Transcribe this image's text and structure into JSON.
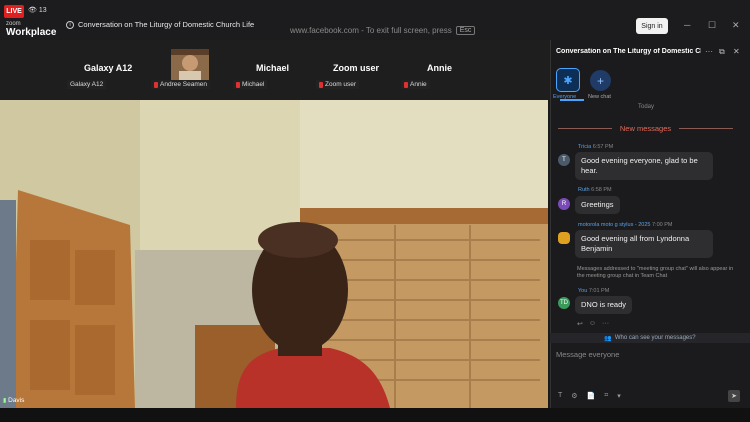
{
  "topbar": {
    "live_label": "LIVE",
    "viewer_count": "13",
    "brand_small": "zoom",
    "brand_large": "Workplace",
    "meeting_title": "Conversation on The Liturgy of Domestic Church Life",
    "fullscreen_notice": "www.facebook.com - To exit full screen, press",
    "esc_key": "Esc",
    "sign_in": "Sign in"
  },
  "gallery": [
    {
      "name": "Galaxy A12",
      "label": "Galaxy A12",
      "muted": false
    },
    {
      "name": "",
      "label": "Andree Seamen",
      "muted": true
    },
    {
      "name": "Michael",
      "label": "Michael",
      "muted": true
    },
    {
      "name": "Zoom user",
      "label": "Zoom user",
      "muted": true
    },
    {
      "name": "Annie",
      "label": "Annie",
      "muted": true
    }
  ],
  "main_video": {
    "speaker": "Davis"
  },
  "chat": {
    "header": "Conversation on The Liturgy of Domestic Ch...",
    "tabs": [
      {
        "label": "Everyone",
        "icon": "everyone-icon",
        "active": true
      },
      {
        "label": "New chat",
        "icon": "plus-icon",
        "active": false
      }
    ],
    "date_divider": "Today",
    "new_messages": "New messages",
    "messages": [
      {
        "initial": "T",
        "sender": "Tricia",
        "time": "6:57 PM",
        "text_lines": [
          "Good evening everyone, glad to be",
          "hear."
        ],
        "avatar_color": "#4a5a6a"
      },
      {
        "initial": "R",
        "sender": "Ruth",
        "time": "6:58 PM",
        "text_lines": [
          "Greetings"
        ],
        "avatar_color": "#7a4bb8"
      },
      {
        "initial": "",
        "sender": "motorola moto g stylus - 2025",
        "time": "7:00 PM",
        "text_lines": [
          "Good evening all  from Lyndonna",
          "Benjamin"
        ],
        "avatar_color": "#e0a020"
      },
      {
        "initial": "TD",
        "sender": "You",
        "time": "7:01 PM",
        "text_lines": [
          "DNO is ready"
        ],
        "avatar_color": "#3a9a5a"
      }
    ],
    "notice": "Messages addressed to \"meeting group chat\" will also appear in the meeting group chat in Team Chat",
    "who_can_see": "Who can see your messages?",
    "compose_placeholder": "Message everyone"
  },
  "colors": {
    "live": "#e02020",
    "accent": "#4aa3ff",
    "new_messages": "#e06a5a"
  }
}
